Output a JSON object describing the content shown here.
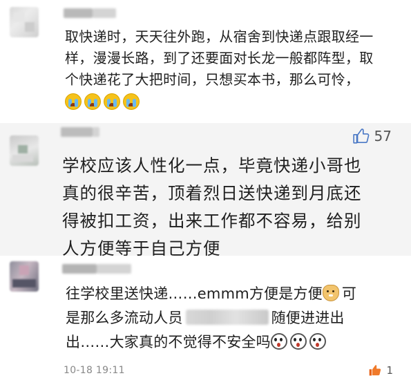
{
  "comments": [
    {
      "text_lines": [
        "取快递时，天天往外跑，从宿舍到快递点跟取经一",
        "样，漫漫长路，到了还要面对长龙一般都阵型，取",
        "个快递花了大把时间，只想买本书，那么可怜，"
      ],
      "emojis": [
        "crying-face",
        "crying-face",
        "crying-face",
        "crying-face"
      ]
    },
    {
      "text_lines": [
        "学校应该人性化一点，毕竟快递小哥也",
        "真的很辛苦，顶着烈日送快递到月底还",
        "得被扣工资，出来工作都不容易，给别",
        "人方便等于自己方便"
      ],
      "likes": "57"
    },
    {
      "text_line1_a": "往学校里送快递……emmm方便是方便",
      "text_line1_b": "可",
      "text_line2_a": "是那么多流动人员",
      "text_line2_b": "随便进进出",
      "text_line3": "出……大家真的不觉得不安全吗",
      "timestamp": "10-18 19:11",
      "likes": "1"
    }
  ],
  "colors": {
    "highlight_background": "#f4f4f4",
    "like_icon": "#555555"
  }
}
